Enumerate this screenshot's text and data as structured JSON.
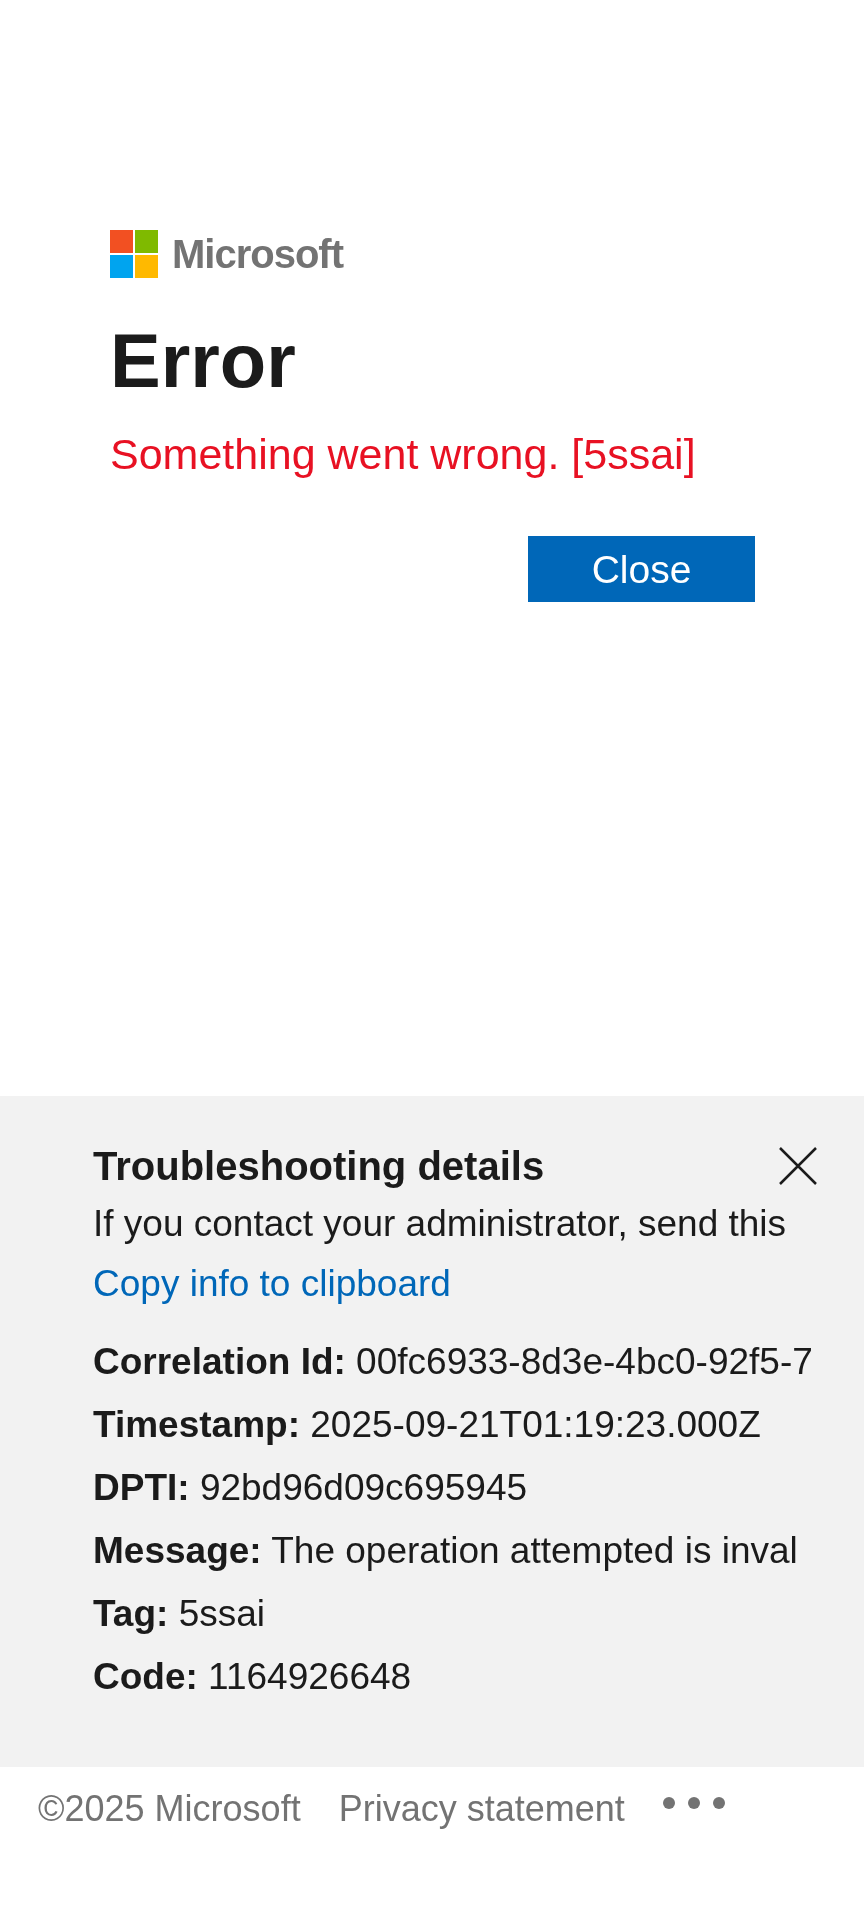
{
  "logo": {
    "text": "Microsoft"
  },
  "title": "Error",
  "error_message": "Something went wrong. [5ssai]",
  "close_button": "Close",
  "troubleshooting": {
    "title": "Troubleshooting details",
    "intro": "If you contact your administrator, send this",
    "copy_link": "Copy info to clipboard",
    "details": [
      "**Correlation Id:** 00fc6933-8d3e-4bc0-92f5-7",
      "**Timestamp:** 2025-09-21T01:19:23.000Z",
      "**DPTI:** 92bd96d09c695945",
      "**Message:** The operation attempted is inval",
      "**Tag:** 5ssai",
      "**Code:** 1164926648"
    ]
  },
  "footer": {
    "copyright": "©2025 Microsoft",
    "links": [
      "Privacy statement"
    ]
  }
}
